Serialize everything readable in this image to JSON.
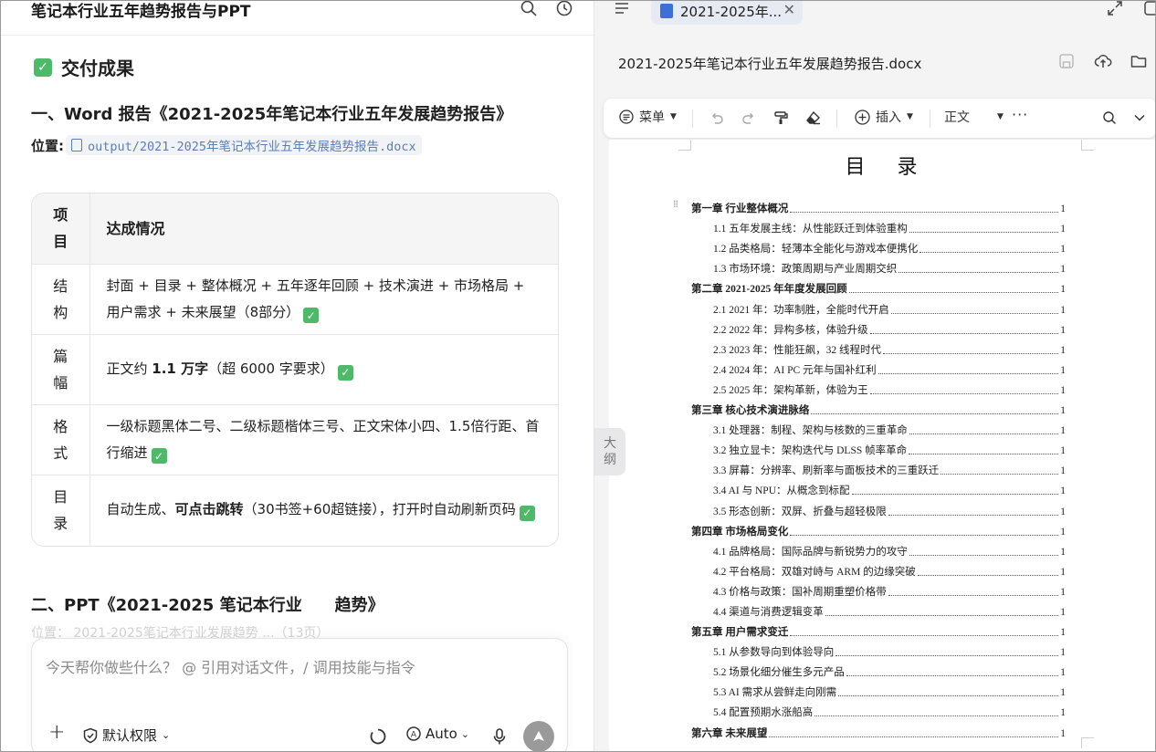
{
  "chat": {
    "title": "笔记本行业五年趋势报告与PPT",
    "deliver_title": "交付成果",
    "section1_title": "一、Word 报告《2021-2025年笔记本行业五年发展趋势报告》",
    "location_label": "位置:",
    "section1_path": "output/2021-2025年笔记本行业五年发展趋势报告.docx",
    "table": {
      "headers": [
        "项目",
        "达成情况"
      ],
      "rows": [
        {
          "item": "结构",
          "parts": [
            "封面 + 目录 + 整体概况 + 五年逐年回顾 + 技术演进 + 市场格局 + 用户需求 + 未来展望（8部分）"
          ]
        },
        {
          "item": "篇幅",
          "pre": "正文约 ",
          "bold": "1.1 万字",
          "post": "（超 6000 字要求）"
        },
        {
          "item": "格式",
          "parts": [
            "一级标题黑体二号、二级标题楷体三号、正文宋体小四、1.5倍行距、首行缩进"
          ]
        },
        {
          "item": "目录",
          "pre": "自动生成、",
          "bold": "可点击跳转",
          "post": "（30书签+60超链接），打开时自动刷新页码"
        }
      ]
    },
    "section2_title_a": "二、PPT《2021-2025 笔记本行业",
    "section2_title_b": "趋势》",
    "section2_location": "位置： 2021-2025笔记本行业发展趋势 ...（13页）",
    "input_placeholder": "今天帮你做些什么？ @ 引用对话文件，/ 调用技能与指令",
    "permission_label": "默认权限",
    "model_label": "Auto"
  },
  "doc": {
    "tab_label": "2021-2025年...",
    "file_title": "2021-2025年笔记本行业五年发展趋势报告.docx",
    "toolbar": {
      "menu": "菜单",
      "insert": "插入",
      "style": "正文"
    },
    "outline_label": "大纲",
    "toc_title": "目 录",
    "toc": [
      {
        "text": "第一章 行业整体概况",
        "page": "1",
        "level": 1
      },
      {
        "text": "1.1 五年发展主线：从性能跃迁到体验重构",
        "page": "1",
        "level": 2
      },
      {
        "text": "1.2 品类格局：轻薄本全能化与游戏本便携化",
        "page": "1",
        "level": 2
      },
      {
        "text": "1.3 市场环境：政策周期与产业周期交织",
        "page": "1",
        "level": 2
      },
      {
        "text": "第二章 2021-2025 年年度发展回顾",
        "page": "1",
        "level": 1
      },
      {
        "text": "2.1 2021 年：功率制胜，全能时代开启",
        "page": "1",
        "level": 2
      },
      {
        "text": "2.2 2022 年：异构多核，体验升级",
        "page": "1",
        "level": 2
      },
      {
        "text": "2.3 2023 年：性能狂飙，32 线程时代",
        "page": "1",
        "level": 2
      },
      {
        "text": "2.4 2024 年：AI PC 元年与国补红利",
        "page": "1",
        "level": 2
      },
      {
        "text": "2.5 2025 年：架构革新，体验为王",
        "page": "1",
        "level": 2
      },
      {
        "text": "第三章 核心技术演进脉络",
        "page": "1",
        "level": 1
      },
      {
        "text": "3.1 处理器：制程、架构与核数的三重革命",
        "page": "1",
        "level": 2
      },
      {
        "text": "3.2 独立显卡：架构迭代与 DLSS 帧率革命",
        "page": "1",
        "level": 2
      },
      {
        "text": "3.3 屏幕：分辨率、刷新率与面板技术的三重跃迁",
        "page": "1",
        "level": 2
      },
      {
        "text": "3.4 AI 与 NPU：从概念到标配",
        "page": "1",
        "level": 2
      },
      {
        "text": "3.5 形态创新：双屏、折叠与超轻极限",
        "page": "1",
        "level": 2
      },
      {
        "text": "第四章 市场格局变化",
        "page": "1",
        "level": 1
      },
      {
        "text": "4.1 品牌格局：国际品牌与新锐势力的攻守",
        "page": "1",
        "level": 2
      },
      {
        "text": "4.2 平台格局：双雄对峙与 ARM 的边缘突破",
        "page": "1",
        "level": 2
      },
      {
        "text": "4.3 价格与政策：国补周期重塑价格带",
        "page": "1",
        "level": 2
      },
      {
        "text": "4.4 渠道与消费逻辑变革",
        "page": "1",
        "level": 2
      },
      {
        "text": "第五章 用户需求变迁",
        "page": "1",
        "level": 1
      },
      {
        "text": "5.1 从参数导向到体验导向",
        "page": "1",
        "level": 2
      },
      {
        "text": "5.2 场景化细分催生多元产品",
        "page": "1",
        "level": 2
      },
      {
        "text": "5.3 AI 需求从尝鲜走向刚需",
        "page": "1",
        "level": 2
      },
      {
        "text": "5.4 配置预期水涨船高",
        "page": "1",
        "level": 2
      },
      {
        "text": "第六章 未来展望",
        "page": "1",
        "level": 1
      }
    ]
  },
  "colors": {
    "check_green": "#4fb96a",
    "doc_blue": "#3c6fd8",
    "link_blue": "#5b7fb5"
  }
}
